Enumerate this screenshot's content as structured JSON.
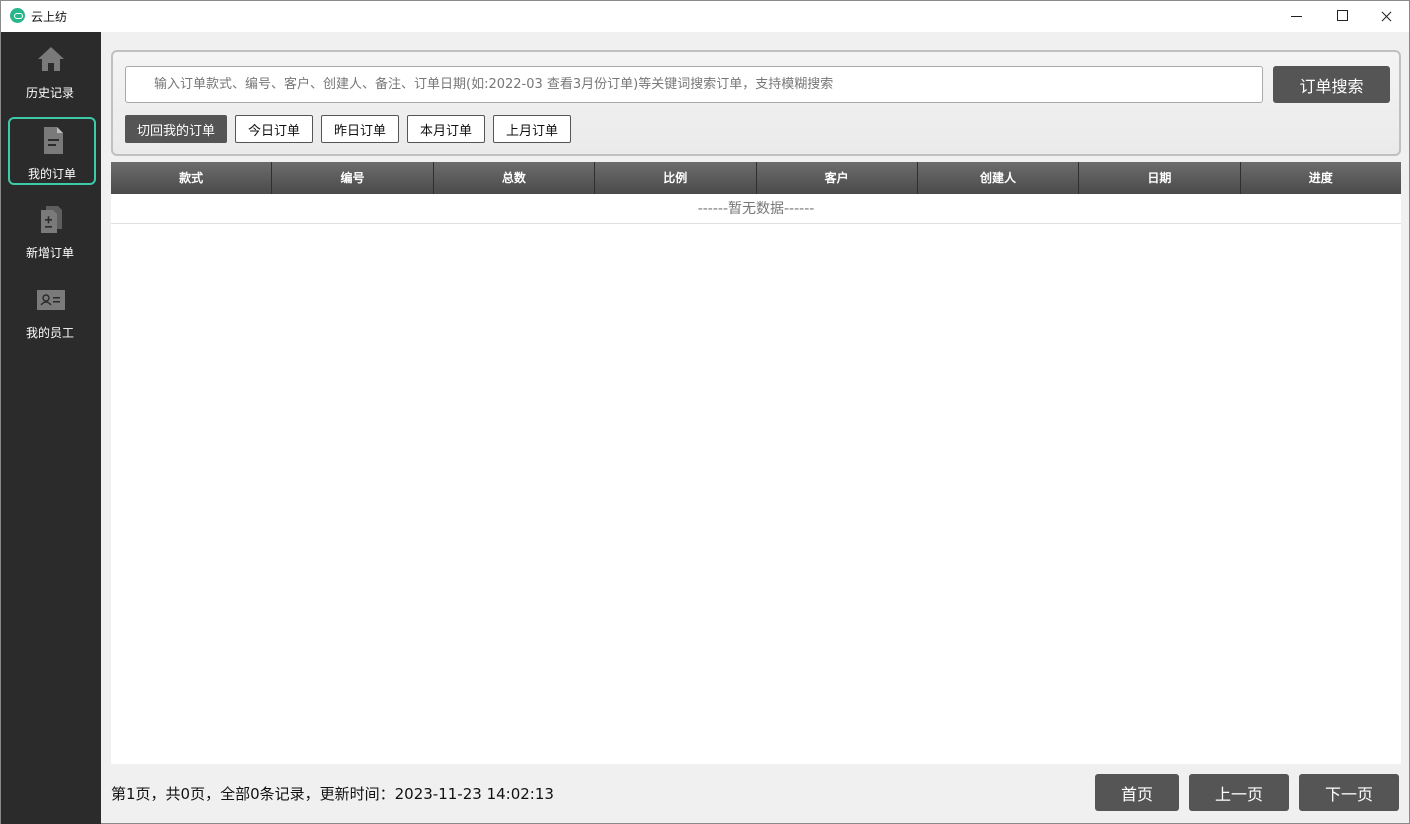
{
  "window": {
    "title": "云上纺"
  },
  "sidebar": {
    "items": [
      {
        "label": "历史记录",
        "icon": "home-icon",
        "active": false
      },
      {
        "label": "我的订单",
        "icon": "document-icon",
        "active": true
      },
      {
        "label": "新增订单",
        "icon": "add-document-icon",
        "active": false
      },
      {
        "label": "我的员工",
        "icon": "id-card-icon",
        "active": false
      }
    ]
  },
  "search": {
    "placeholder": "输入订单款式、编号、客户、创建人、备注、订单日期(如:2022-03 查看3月份订单)等关键词搜索订单，支持模糊搜索",
    "value": "",
    "button_label": "订单搜索",
    "filters": [
      "切回我的订单",
      "今日订单",
      "昨日订单",
      "本月订单",
      "上月订单"
    ]
  },
  "table": {
    "columns": [
      "款式",
      "编号",
      "总数",
      "比例",
      "客户",
      "创建人",
      "日期",
      "进度"
    ],
    "empty_text": "------暂无数据------"
  },
  "footer": {
    "status": "第1页，共0页，全部0条记录，更新时间：2023-11-23 14:02:13",
    "first_label": "首页",
    "prev_label": "上一页",
    "next_label": "下一页"
  },
  "colors": {
    "sidebar_bg": "#2b2b2b",
    "accent": "#3ec9a7",
    "button_dark": "#555555"
  }
}
